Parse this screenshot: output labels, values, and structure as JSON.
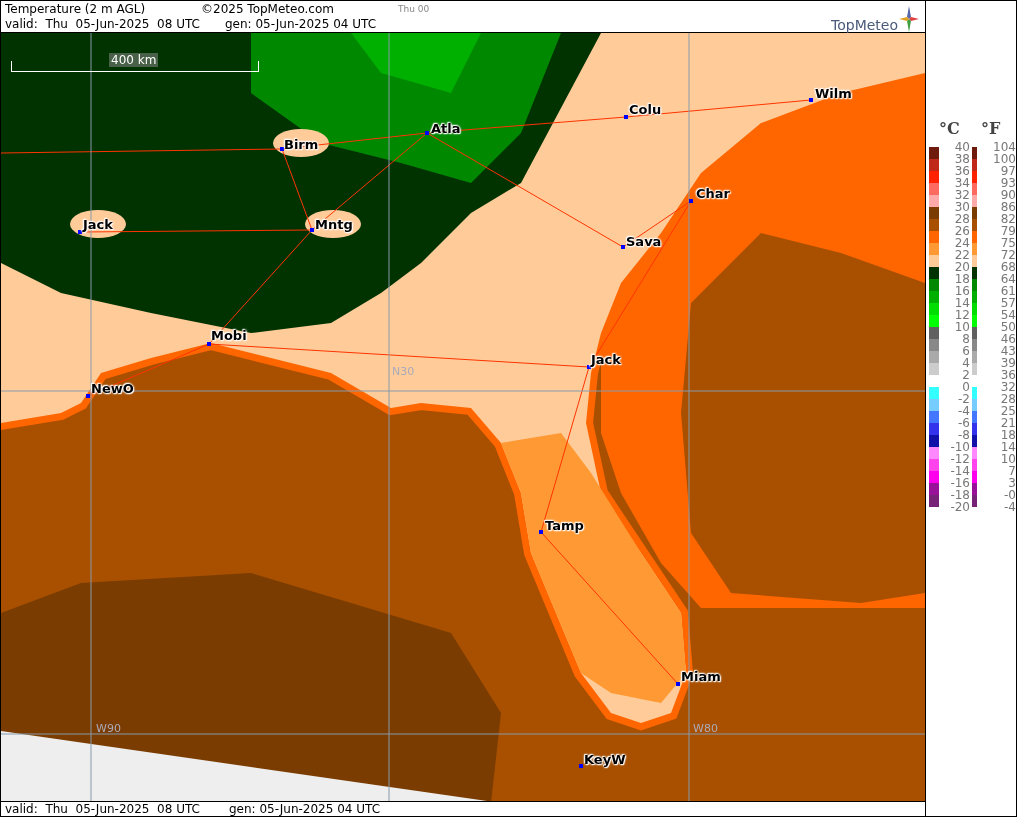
{
  "header": {
    "title": "Temperature (2 m AGL)",
    "copyright": "©2025 TopMeteo.com",
    "run": "Thu 00",
    "valid": "valid:  Thu  05-Jun-2025  08 UTC",
    "generated": "gen: 05-Jun-2025 04 UTC",
    "logo": "TopMeteo"
  },
  "map": {
    "scale": "400 km",
    "grid_labels": [
      "N30",
      "W90",
      "W80"
    ],
    "cities": [
      {
        "name": "Wilm"
      },
      {
        "name": "Colu"
      },
      {
        "name": "Atla"
      },
      {
        "name": "Birm"
      },
      {
        "name": "Char"
      },
      {
        "name": "Jack"
      },
      {
        "name": "Mntg"
      },
      {
        "name": "Sava"
      },
      {
        "name": "Mobi"
      },
      {
        "name": "Jack"
      },
      {
        "name": "NewO"
      },
      {
        "name": "Tamp"
      },
      {
        "name": "Miam"
      },
      {
        "name": "KeyW"
      }
    ]
  },
  "legend": {
    "units": [
      "°C",
      "°F"
    ],
    "groups": [
      {
        "ticks": [
          {
            "c": "40",
            "f": "104"
          },
          {
            "c": "38",
            "f": "100"
          },
          {
            "c": "36",
            "f": "97"
          },
          {
            "c": "34",
            "f": "93"
          },
          {
            "c": "32",
            "f": "90"
          },
          {
            "c": "30",
            "f": "86"
          },
          {
            "c": "28",
            "f": "82"
          },
          {
            "c": "26",
            "f": "79"
          },
          {
            "c": "24",
            "f": "75"
          },
          {
            "c": "22",
            "f": "72"
          },
          {
            "c": "20",
            "f": "68"
          },
          {
            "c": "18",
            "f": "64"
          },
          {
            "c": "16",
            "f": "61"
          },
          {
            "c": "14",
            "f": "57"
          },
          {
            "c": "12",
            "f": "54"
          },
          {
            "c": "10",
            "f": "50"
          },
          {
            "c": "8",
            "f": "46"
          },
          {
            "c": "6",
            "f": "43"
          },
          {
            "c": "4",
            "f": "39"
          },
          {
            "c": "2",
            "f": "36"
          }
        ],
        "bands": [
          {
            "color": "#6e1a0c"
          },
          {
            "color": "#c0281a"
          },
          {
            "color": "#ff2200"
          },
          {
            "color": "#ff6a60"
          },
          {
            "color": "#ffaaaa"
          },
          {
            "color": "#7a3c00"
          },
          {
            "color": "#a85000"
          },
          {
            "color": "#ff6600"
          },
          {
            "color": "#ff9933"
          },
          {
            "color": "#ffcc99"
          },
          {
            "color": "#003300"
          },
          {
            "color": "#008800"
          },
          {
            "color": "#00b000"
          },
          {
            "color": "#00dd00"
          },
          {
            "color": "#00ff00"
          },
          {
            "color": "#606060"
          },
          {
            "color": "#888888"
          },
          {
            "color": "#aaaaaa"
          },
          {
            "color": "#cccccc"
          }
        ]
      },
      {
        "ticks": [
          {
            "c": "0",
            "f": "32"
          },
          {
            "c": "-2",
            "f": "28"
          },
          {
            "c": "-4",
            "f": "25"
          },
          {
            "c": "-6",
            "f": "21"
          },
          {
            "c": "-8",
            "f": "18"
          },
          {
            "c": "-10",
            "f": "14"
          },
          {
            "c": "-12",
            "f": "10"
          },
          {
            "c": "-14",
            "f": "7"
          },
          {
            "c": "-16",
            "f": "3"
          },
          {
            "c": "-18",
            "f": "-0"
          },
          {
            "c": "-20",
            "f": "-4"
          }
        ],
        "bands": [
          {
            "color": "#33ffff"
          },
          {
            "color": "#77ccff"
          },
          {
            "color": "#4477ff"
          },
          {
            "color": "#3333ee"
          },
          {
            "color": "#1111aa"
          },
          {
            "color": "#ff88ff"
          },
          {
            "color": "#ff44ee"
          },
          {
            "color": "#ff00ee"
          },
          {
            "color": "#991199"
          },
          {
            "color": "#772277"
          }
        ]
      }
    ]
  },
  "footer": {
    "valid": "valid:  Thu  05-Jun-2025  08 UTC",
    "generated": "gen: 05-Jun-2025 04 UTC"
  }
}
